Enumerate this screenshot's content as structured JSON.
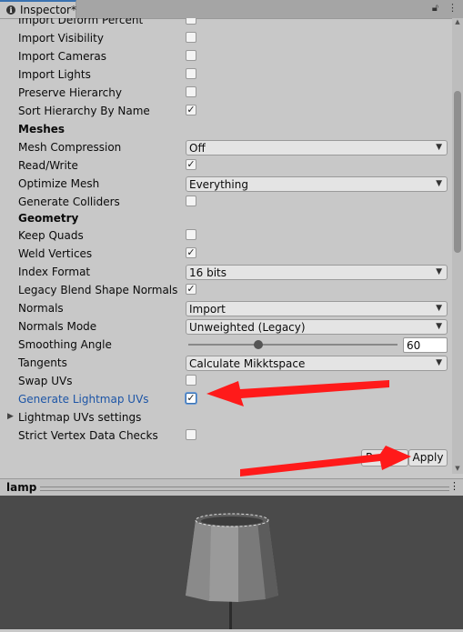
{
  "tab": {
    "title": "Inspector*",
    "icons": [
      "lock-icon",
      "more-icon"
    ]
  },
  "rows": [
    {
      "id": "import-deform-percent",
      "label": "Import Deform Percent",
      "type": "checkbox",
      "checked": false
    },
    {
      "id": "import-visibility",
      "label": "Import Visibility",
      "type": "checkbox",
      "checked": false
    },
    {
      "id": "import-cameras",
      "label": "Import Cameras",
      "type": "checkbox",
      "checked": false
    },
    {
      "id": "import-lights",
      "label": "Import Lights",
      "type": "checkbox",
      "checked": false
    },
    {
      "id": "preserve-hierarchy",
      "label": "Preserve Hierarchy",
      "type": "checkbox",
      "checked": false
    },
    {
      "id": "sort-hierarchy",
      "label": "Sort Hierarchy By Name",
      "type": "checkbox",
      "checked": true
    },
    {
      "id": "meshes-header",
      "label": "Meshes",
      "type": "header"
    },
    {
      "id": "mesh-compression",
      "label": "Mesh Compression",
      "type": "dropdown",
      "value": "Off"
    },
    {
      "id": "read-write",
      "label": "Read/Write",
      "type": "checkbox",
      "checked": true
    },
    {
      "id": "optimize-mesh",
      "label": "Optimize Mesh",
      "type": "dropdown",
      "value": "Everything"
    },
    {
      "id": "generate-colliders",
      "label": "Generate Colliders",
      "type": "checkbox",
      "checked": false
    },
    {
      "id": "geometry-header",
      "label": "Geometry",
      "type": "header"
    },
    {
      "id": "keep-quads",
      "label": "Keep Quads",
      "type": "checkbox",
      "checked": false
    },
    {
      "id": "weld-vertices",
      "label": "Weld Vertices",
      "type": "checkbox",
      "checked": true
    },
    {
      "id": "index-format",
      "label": "Index Format",
      "type": "dropdown",
      "value": "16 bits"
    },
    {
      "id": "legacy-blend",
      "label": "Legacy Blend Shape Normals",
      "type": "checkbox",
      "checked": true
    },
    {
      "id": "normals",
      "label": "Normals",
      "type": "dropdown",
      "value": "Import"
    },
    {
      "id": "normals-mode",
      "label": "Normals Mode",
      "type": "dropdown",
      "value": "Unweighted (Legacy)"
    },
    {
      "id": "smoothing-angle",
      "label": "Smoothing Angle",
      "type": "slider",
      "value": "60",
      "fraction": 0.333
    },
    {
      "id": "tangents",
      "label": "Tangents",
      "type": "dropdown",
      "value": "Calculate Mikktspace"
    },
    {
      "id": "swap-uvs",
      "label": "Swap UVs",
      "type": "checkbox",
      "checked": false
    },
    {
      "id": "generate-lightmap-uvs",
      "label": "Generate Lightmap UVs",
      "type": "checkbox",
      "checked": true,
      "highlight": true
    },
    {
      "id": "lightmap-uvs-settings",
      "label": "Lightmap UVs settings",
      "type": "foldout"
    },
    {
      "id": "strict-vertex",
      "label": "Strict Vertex Data Checks",
      "type": "checkbox",
      "checked": false
    }
  ],
  "buttons": {
    "revert": "Revert",
    "apply": "Apply"
  },
  "preview": {
    "name": "lamp"
  },
  "colors": {
    "arrow": "#ff1a1a",
    "accent": "#3a72b0",
    "label_modified": "#1d55a6"
  }
}
